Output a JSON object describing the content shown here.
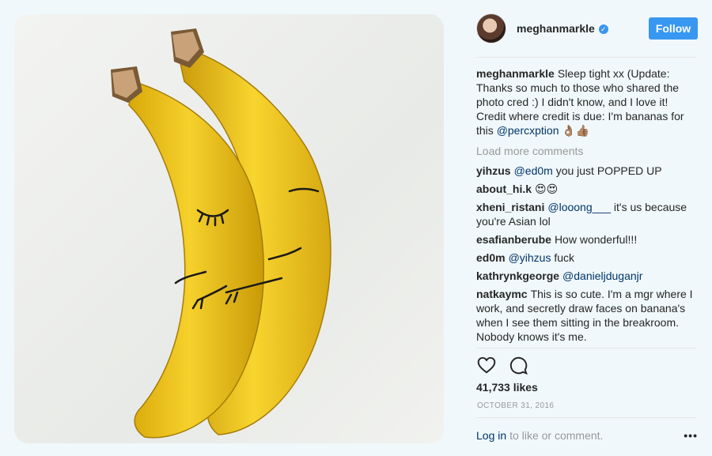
{
  "post": {
    "username": "meghanmarkle",
    "follow_label": "Follow",
    "caption_user": "meghanmarkle",
    "caption_text": "Sleep tight xx (Update: Thanks so much to those who shared the photo cred :) I didn't know, and I love it! Credit where credit is due: I'm bananas for this ",
    "caption_mention": "@percxption",
    "caption_emoji": " 👌🏽👍🏽",
    "load_more": "Load more comments",
    "likes": "41,733 likes",
    "date": "October 31, 2016",
    "login_label": "Log in",
    "login_suffix": "to like or comment.",
    "more_icon": "•••"
  },
  "comments": [
    {
      "user": "yihzus",
      "mention": "@ed0m",
      "text": " you just POPPED UP"
    },
    {
      "user": "about_hi.k",
      "mention": "",
      "text": "😍😍"
    },
    {
      "user": "xheni_ristani",
      "mention": "@looong___",
      "text": " it's us because you're Asian lol"
    },
    {
      "user": "esafianberube",
      "mention": "",
      "text": "How wonderful!!!"
    },
    {
      "user": "ed0m",
      "mention": "@yihzus",
      "text": " fuck"
    },
    {
      "user": "kathrynkgeorge",
      "mention": "@danieljduganjr",
      "text": ""
    },
    {
      "user": "natkaymc",
      "mention": "",
      "text": "This is so cute. I'm a mgr where I work, and secretly draw faces on banana's when I see them sitting in the breakroom. Nobody knows it's me."
    }
  ],
  "colors": {
    "accent": "#3897f0",
    "link": "#003569",
    "muted": "#999999"
  },
  "icons": [
    "verified-badge-icon",
    "heart-icon",
    "comment-icon",
    "more-options-icon"
  ]
}
